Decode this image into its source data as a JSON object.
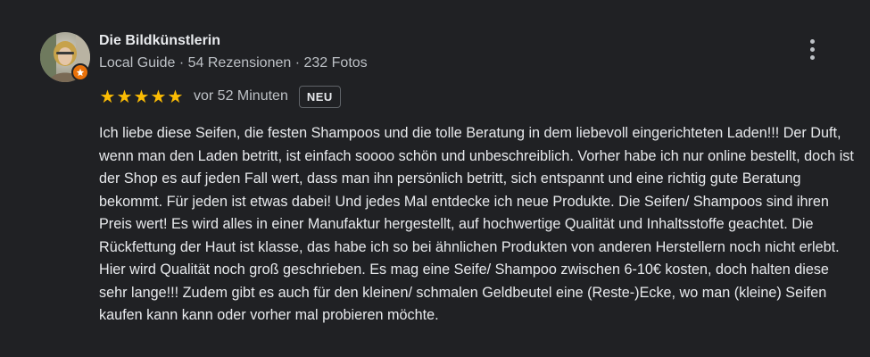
{
  "author": {
    "name": "Die Bildkünstlerin",
    "badge": "Local Guide",
    "reviews": "54 Rezensionen",
    "photos": "232 Fotos",
    "separator": "·"
  },
  "rating": {
    "stars": 5,
    "max_stars": 5,
    "time_ago": "vor 52 Minuten",
    "new_badge": "NEU"
  },
  "review": {
    "text": "Ich liebe diese Seifen, die festen Shampoos und die tolle Beratung in dem liebevoll eingerichteten Laden!!! Der Duft, wenn man den Laden betritt, ist einfach soooo schön und unbeschreiblich. Vorher habe ich nur online bestellt, doch ist der Shop es auf jeden Fall wert, dass man ihn persönlich betritt, sich entspannt und eine richtig gute Beratung bekommt. Für jeden ist etwas dabei! Und jedes Mal entdecke ich neue Produkte. Die Seifen/ Shampoos sind ihren Preis wert! Es wird alles in einer Manufaktur hergestellt, auf hochwertige Qualität und Inhaltsstoffe geachtet. Die Rückfettung der Haut ist klasse, das habe ich so bei ähnlichen Produkten von anderen Herstellern noch nicht erlebt. Hier wird Qualität noch groß geschrieben. Es mag eine Seife/ Shampoo zwischen 6-10€ kosten, doch halten diese sehr lange!!! Zudem gibt es auch für den kleinen/ schmalen Geldbeutel eine (Reste-)Ecke, wo man (kleine) Seifen kaufen kann kann oder vorher mal probieren möchte."
  },
  "icons": {
    "avatar": "profile-photo",
    "guide_badge": "local-guide-star-icon",
    "more": "more-vertical-icon",
    "star": "star-icon"
  },
  "colors": {
    "background": "#202124",
    "star": "#fbbc04",
    "guide_badge": "#e8710a",
    "text_primary": "#e8eaed",
    "text_secondary": "#bdc1c6"
  }
}
